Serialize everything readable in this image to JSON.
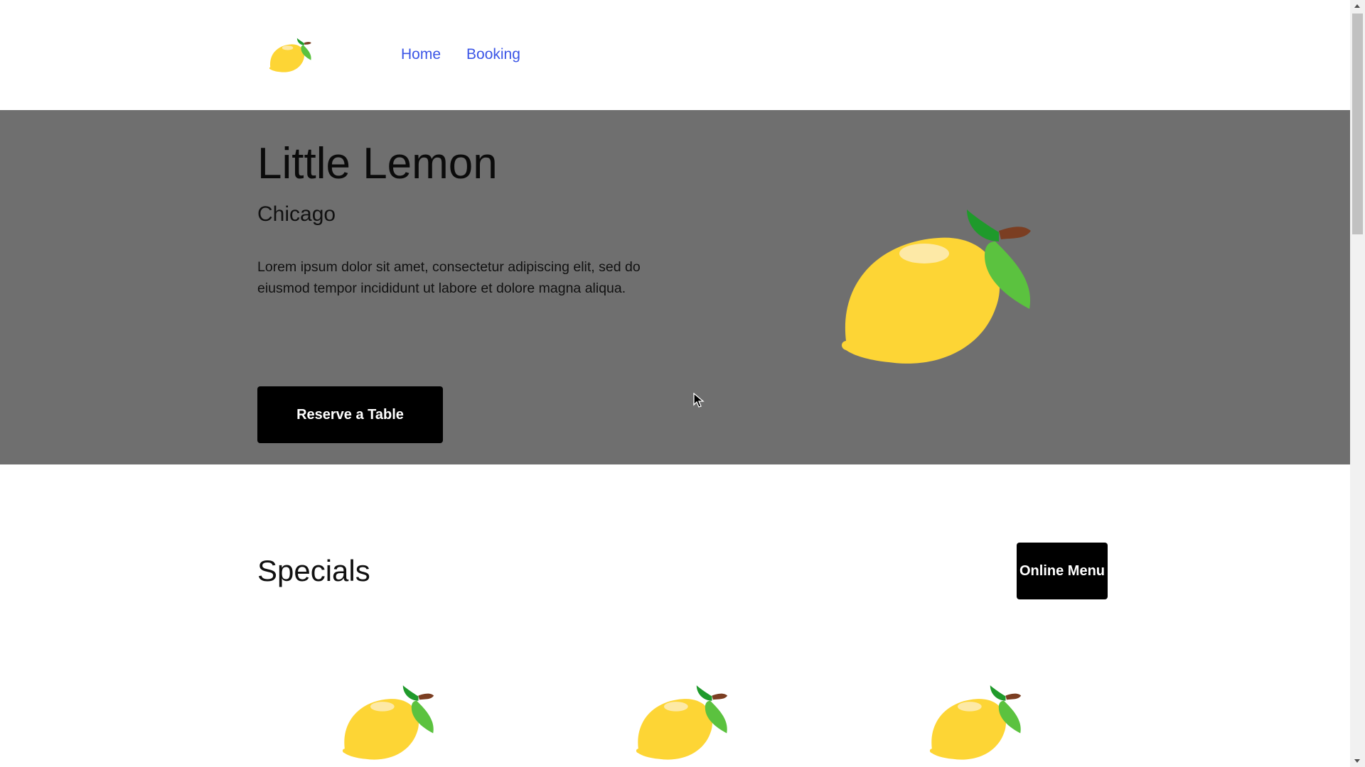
{
  "nav": {
    "items": [
      {
        "label": "Home"
      },
      {
        "label": "Booking"
      }
    ]
  },
  "hero": {
    "title": "Little Lemon",
    "city": "Chicago",
    "description": "Lorem ipsum dolor sit amet, consectetur adipiscing elit, sed do eiusmod tempor incididunt ut labore et dolore magna aliqua.",
    "reserve_label": "Reserve a Table"
  },
  "specials": {
    "title": "Specials",
    "online_menu_label": "Online Menu"
  },
  "icons": {
    "logo": "lemon-icon",
    "hero_image": "lemon-icon",
    "card_image": "lemon-icon"
  },
  "colors": {
    "hero_bg": "#6f6f6f",
    "nav_link": "#3b55e6",
    "button_bg": "#000000",
    "lemon": "#fdd535",
    "leaf": "#5bc23f",
    "stem": "#7b3e22"
  }
}
